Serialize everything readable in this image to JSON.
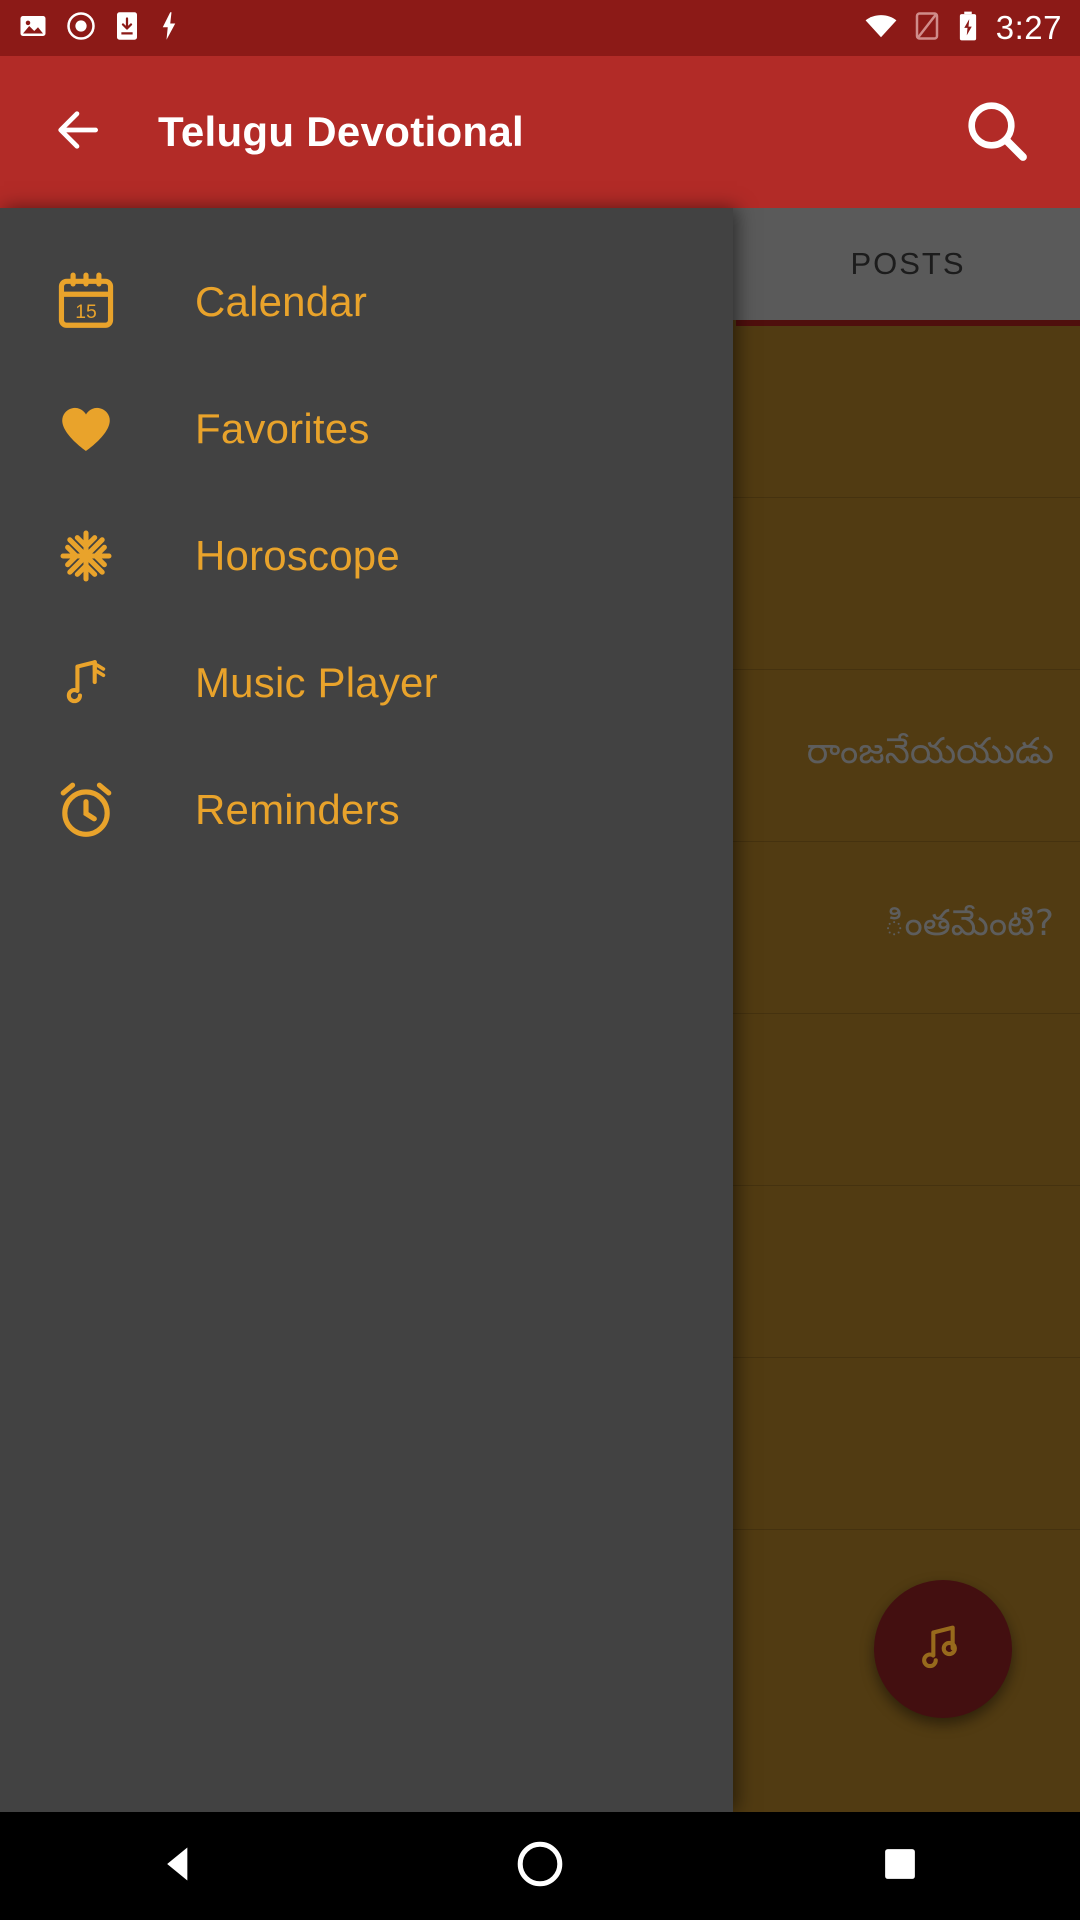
{
  "status_bar": {
    "icons": [
      "image-icon",
      "record-icon",
      "download-app-icon",
      "flash-icon",
      "wifi-icon",
      "sim-off-icon",
      "battery-charging-icon"
    ],
    "time": "3:27",
    "background": "#8c1a17"
  },
  "app_bar": {
    "back_icon": "back-arrow-icon",
    "title": "Telugu Devotional",
    "search_icon": "search-icon",
    "background": "#b22b27"
  },
  "tabs": [
    {
      "label": "POSTS",
      "selected": true
    }
  ],
  "drawer": {
    "background": "#424242",
    "accent": "#e9a32b",
    "items": [
      {
        "icon": "calendar-icon",
        "label": "Calendar"
      },
      {
        "icon": "heart-icon",
        "label": "Favorites"
      },
      {
        "icon": "horoscope-star-icon",
        "label": "Horoscope"
      },
      {
        "icon": "music-note-icon",
        "label": "Music Player"
      },
      {
        "icon": "alarm-clock-icon",
        "label": "Reminders"
      }
    ]
  },
  "content": {
    "background": "#7d5b1c",
    "posts": [
      {
        "text": ""
      },
      {
        "text": ""
      },
      {
        "text": "రాంజనేయయుడు"
      },
      {
        "text": "ింతమేంటి?"
      },
      {
        "text": ""
      },
      {
        "text": ""
      },
      {
        "text": ""
      }
    ],
    "fab": {
      "icon": "music-note-icon",
      "color": "#67171a"
    }
  },
  "nav_bar": {
    "back": "triangle-back-icon",
    "home": "circle-home-icon",
    "recents": "square-recents-icon"
  }
}
